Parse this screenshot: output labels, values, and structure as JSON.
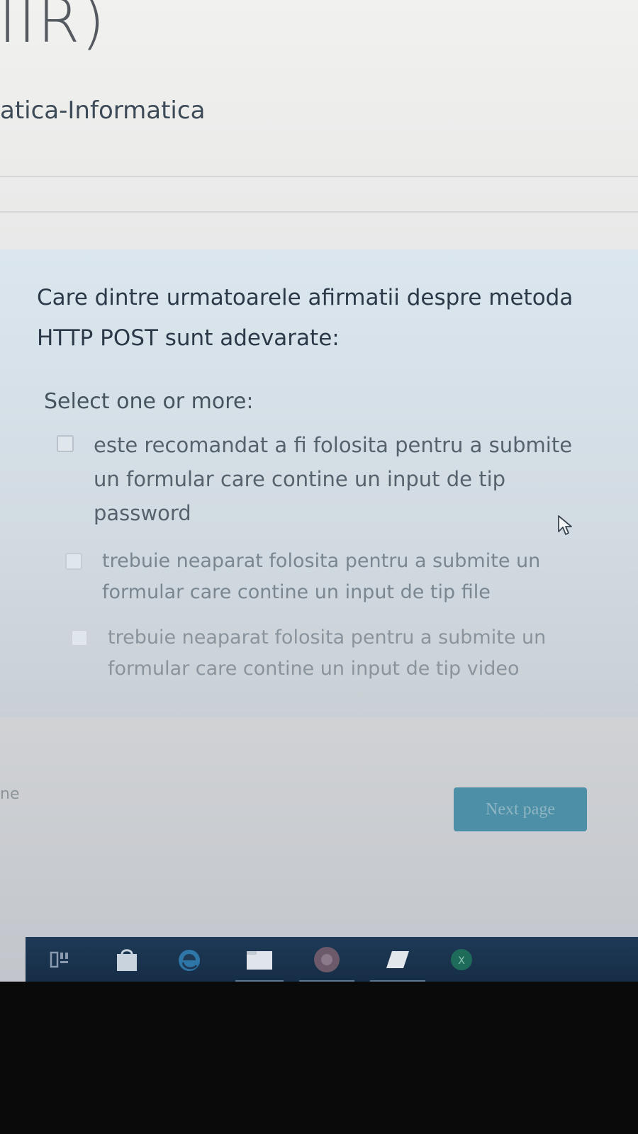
{
  "header": {
    "title": "IIR)",
    "subtitle": "atica-Informatica"
  },
  "question": {
    "text": "Care dintre urmatoarele afirmatii despre metoda HTTP POST sunt adevarate:",
    "prompt": "Select one or more:",
    "options": [
      {
        "label": "este recomandat a fi folosita pentru a submite un formular care contine un input de tip password",
        "checked": false
      },
      {
        "label": "trebuie neaparat folosita pentru a submite un formular care contine un input de tip file",
        "checked": false
      },
      {
        "label": "trebuie neaparat folosita pentru a submite un formular care contine un input de tip video",
        "checked": false
      }
    ]
  },
  "navigation": {
    "left_fragment": "ne",
    "next_label": "Next page",
    "next_color": "#4c8fa6"
  },
  "taskbar": {
    "color": "#1e3a57",
    "icons": [
      "task-view-icon",
      "store-bag-icon",
      "edge-browser-icon",
      "file-explorer-icon",
      "chrome-browser-icon",
      "app-icon",
      "excel-icon"
    ]
  }
}
